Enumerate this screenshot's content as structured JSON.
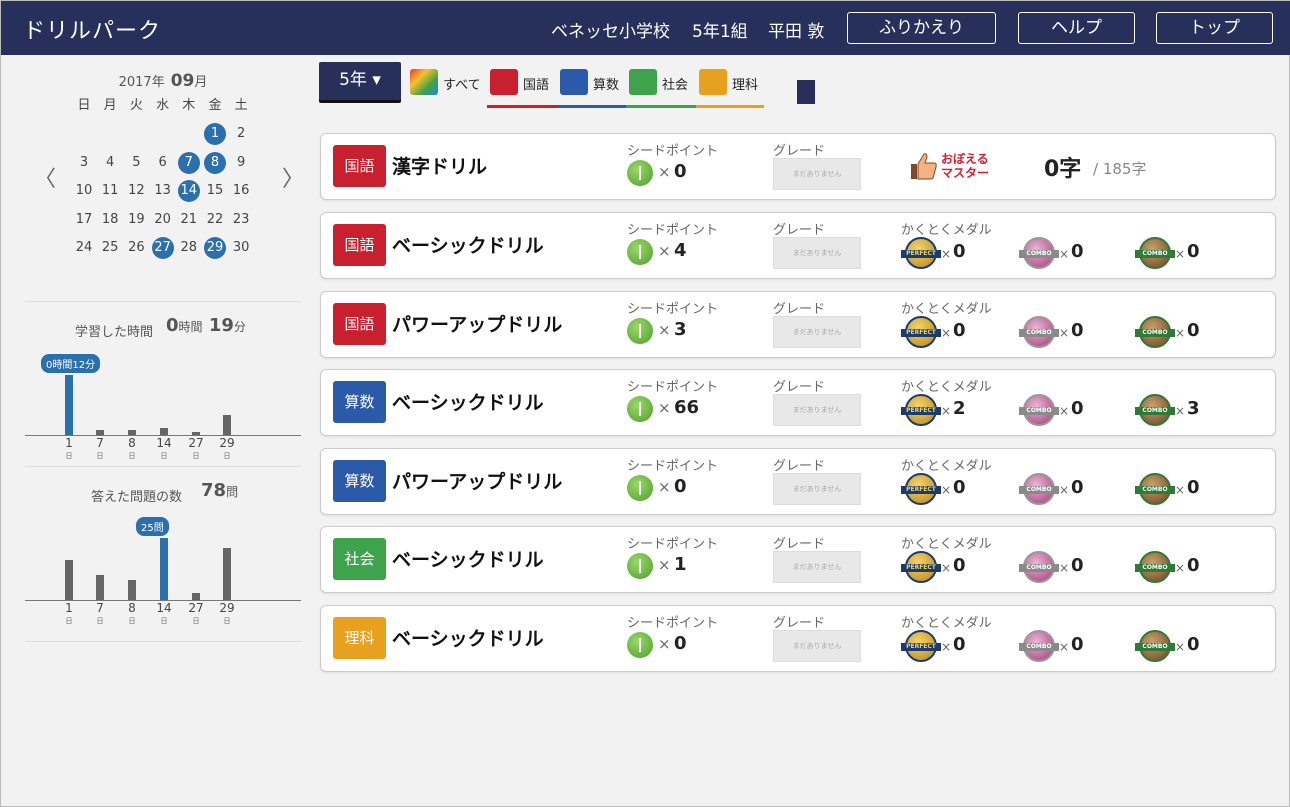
{
  "header": {
    "title": "ドリルパーク",
    "school": "ベネッセ小学校",
    "class": "5年1組",
    "student": "平田 敦",
    "buttons": [
      "ふりかえり",
      "ヘルプ",
      "トップ"
    ]
  },
  "calendar": {
    "year_label": "2017年",
    "month": "09",
    "month_unit": "月",
    "weekdays": [
      "日",
      "月",
      "火",
      "水",
      "木",
      "金",
      "土"
    ],
    "weeks": [
      [
        "",
        "",
        "",
        "",
        "",
        "1",
        "2"
      ],
      [
        "3",
        "4",
        "5",
        "6",
        "7",
        "8",
        "9"
      ],
      [
        "10",
        "11",
        "12",
        "13",
        "14",
        "15",
        "16"
      ],
      [
        "17",
        "18",
        "19",
        "20",
        "21",
        "22",
        "23"
      ],
      [
        "24",
        "25",
        "26",
        "27",
        "28",
        "29",
        "30"
      ]
    ],
    "highlighted": [
      "1",
      "7",
      "8",
      "14",
      "27",
      "29"
    ],
    "prev": "〈",
    "next": "〉"
  },
  "study_time": {
    "label": "学習した時間",
    "hours": "0",
    "hours_unit": "時間",
    "minutes": "19",
    "minutes_unit": "分",
    "tooltip": "0時間12分"
  },
  "answered": {
    "label": "答えた問題の数",
    "value": "78",
    "unit": "問",
    "tooltip": "25問"
  },
  "chart_data": [
    {
      "type": "bar",
      "categories": [
        "1",
        "7",
        "8",
        "14",
        "27",
        "29"
      ],
      "category_unit": "日",
      "values": [
        12,
        1,
        1,
        1.5,
        0.5,
        4
      ],
      "highlight": "1",
      "unit": "min"
    },
    {
      "type": "bar",
      "categories": [
        "1",
        "7",
        "8",
        "14",
        "27",
        "29"
      ],
      "category_unit": "日",
      "values": [
        16,
        10,
        8,
        25,
        3,
        21
      ],
      "highlight": "14",
      "unit": "問"
    }
  ],
  "toolbar": {
    "grade": "5年 ▾",
    "tabs": [
      {
        "label": "すべて",
        "color": "#d7d7d7"
      },
      {
        "label": "国語",
        "color": "#c8202e"
      },
      {
        "label": "算数",
        "color": "#2b5ba8"
      },
      {
        "label": "社会",
        "color": "#3fa34d"
      },
      {
        "label": "理科",
        "color": "#e8a020"
      }
    ]
  },
  "labels": {
    "seed": "シードポイント",
    "grade": "グレード",
    "medals": "かくとくメダル",
    "grade_placeholder": "まだありません",
    "times": "×",
    "perfect": "PERFECT",
    "combo": "COMBO",
    "master_1": "おぼえる",
    "master_2": "マスター"
  },
  "drills": [
    {
      "subject": "国語",
      "color": "#c8202e",
      "name": "漢字ドリル",
      "seeds": "0",
      "kanji": true,
      "kanji_value": "0字",
      "kanji_total": "/ 185字"
    },
    {
      "subject": "国語",
      "color": "#c8202e",
      "name": "ベーシックドリル",
      "seeds": "4",
      "medals": [
        "0",
        "0",
        "0"
      ]
    },
    {
      "subject": "国語",
      "color": "#c8202e",
      "name": "パワーアップドリル",
      "seeds": "3",
      "medals": [
        "0",
        "0",
        "0"
      ]
    },
    {
      "subject": "算数",
      "color": "#2b5ba8",
      "name": "ベーシックドリル",
      "seeds": "66",
      "medals": [
        "2",
        "0",
        "3"
      ]
    },
    {
      "subject": "算数",
      "color": "#2b5ba8",
      "name": "パワーアップドリル",
      "seeds": "0",
      "medals": [
        "0",
        "0",
        "0"
      ]
    },
    {
      "subject": "社会",
      "color": "#3fa34d",
      "name": "ベーシックドリル",
      "seeds": "1",
      "medals": [
        "0",
        "0",
        "0"
      ]
    },
    {
      "subject": "理科",
      "color": "#e8a020",
      "name": "ベーシックドリル",
      "seeds": "0",
      "medals": [
        "0",
        "0",
        "0"
      ]
    }
  ]
}
